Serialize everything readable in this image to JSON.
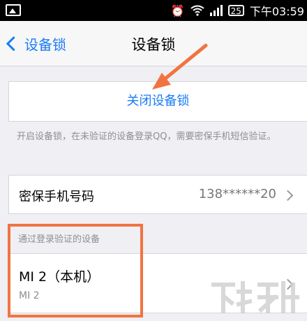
{
  "status_bar": {
    "battery": "25",
    "time": "下午03:59"
  },
  "navbar": {
    "back_label": "设备锁",
    "title": "设备锁"
  },
  "close_button": {
    "label": "关闭设备锁"
  },
  "note": {
    "text": "开启设备锁，在未验证的设备登录QQ，需要密保手机短信验证。"
  },
  "phone_row": {
    "label": "密保手机号码",
    "value": "138******20"
  },
  "devices_section": {
    "header": "通过登录验证的设备",
    "device": {
      "name": "MI 2（本机）",
      "model": "MI 2"
    }
  },
  "colors": {
    "accent": "#1a7cf5",
    "annotation": "#f07441",
    "background": "#efeff4"
  }
}
